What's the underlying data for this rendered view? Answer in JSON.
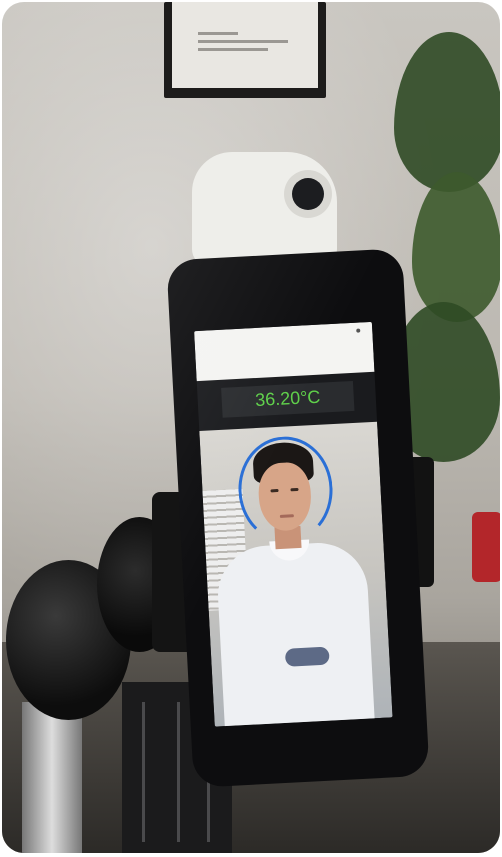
{
  "screen": {
    "app_bar_title": "",
    "temperature": "36.20°C",
    "badge_text": ""
  },
  "colors": {
    "temperature_text": "#5fd04a",
    "face_ring": "#2a6fd6",
    "app_bar": "#f4f4f2"
  },
  "icons": {
    "status_indicator": "status-dot-icon"
  }
}
